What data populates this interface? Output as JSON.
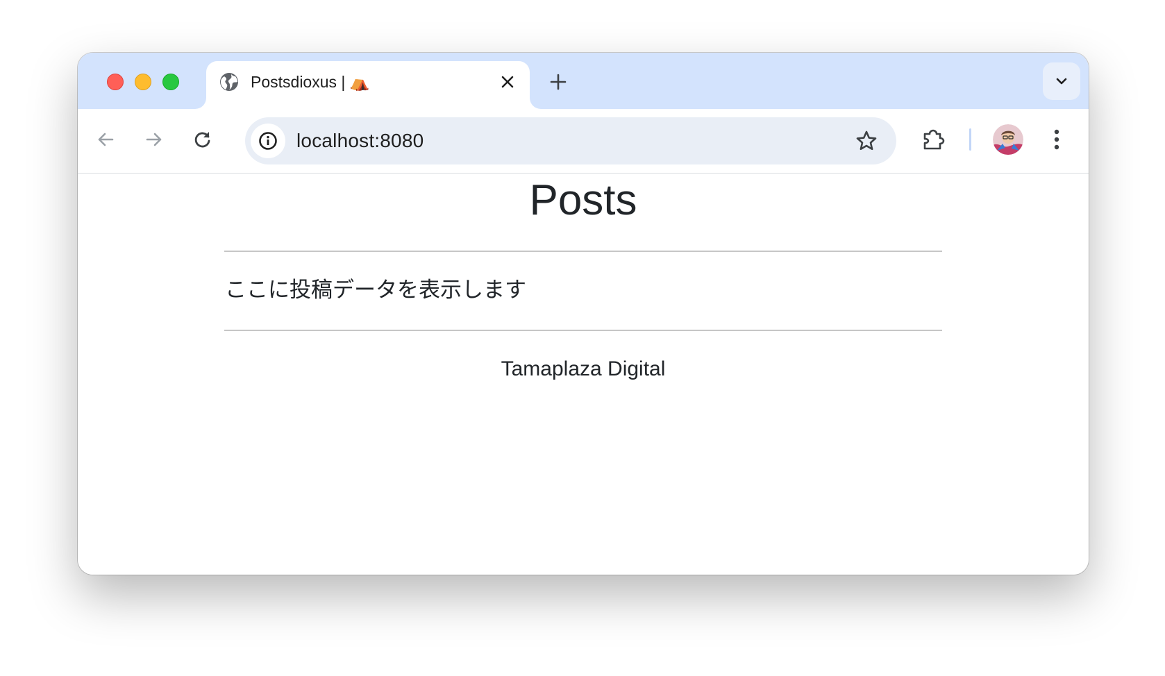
{
  "browser": {
    "tab": {
      "title": "Postsdioxus | ⛺",
      "favicon": "globe-icon"
    },
    "address_bar": {
      "url": "localhost:8080",
      "site_info_icon": "info-icon"
    },
    "colors": {
      "tabstrip": "#d3e3fd",
      "omnibox": "#e9eef6",
      "close_light": "#ff5f57",
      "minimize_light": "#febc2e",
      "maximize_light": "#28c840"
    }
  },
  "page": {
    "title": "Posts",
    "body_text": "ここに投稿データを表示します",
    "footer_text": "Tamaplaza Digital"
  }
}
